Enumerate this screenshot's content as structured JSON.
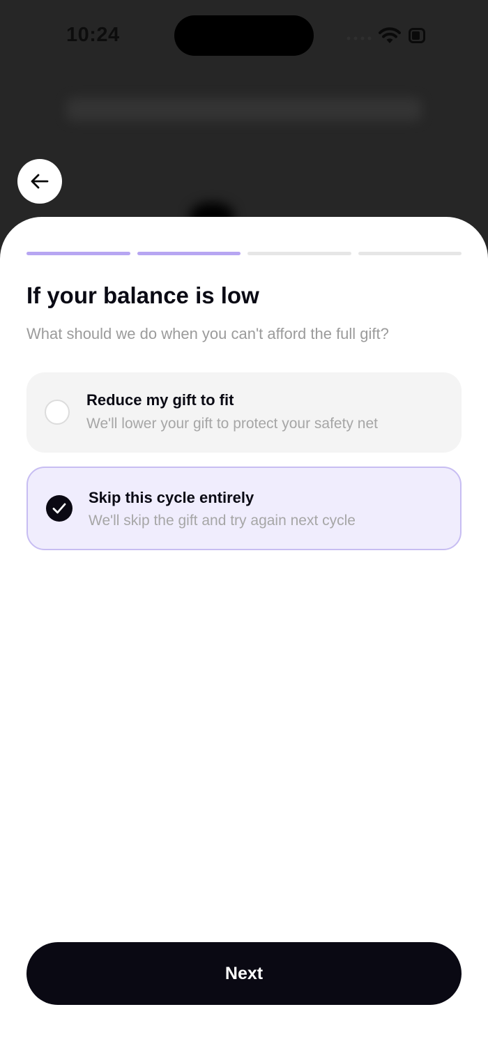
{
  "status_bar": {
    "time": "10:24",
    "icons": [
      "cellular-signal-icon",
      "wifi-icon",
      "battery-icon"
    ]
  },
  "header": {
    "back_icon": "arrow-left-icon"
  },
  "progress": {
    "total_steps": 4,
    "completed_steps": 2,
    "active_color": "#b7a6f2",
    "inactive_color": "#e6e6e6"
  },
  "main": {
    "title": "If your balance is low",
    "subtitle": "What should we do when you can't afford the full gift?",
    "options": [
      {
        "title": "Reduce my gift to fit",
        "description": "We'll lower your gift to protect your safety net",
        "selected": false
      },
      {
        "title": "Skip this cycle entirely",
        "description": "We'll skip the gift and try again next cycle",
        "selected": true
      }
    ]
  },
  "footer": {
    "next_label": "Next"
  },
  "colors": {
    "selected_background": "#f0edfd",
    "selected_border": "#c7bdf2",
    "primary_button": "#0a0913",
    "overlay_background": "#262626"
  }
}
